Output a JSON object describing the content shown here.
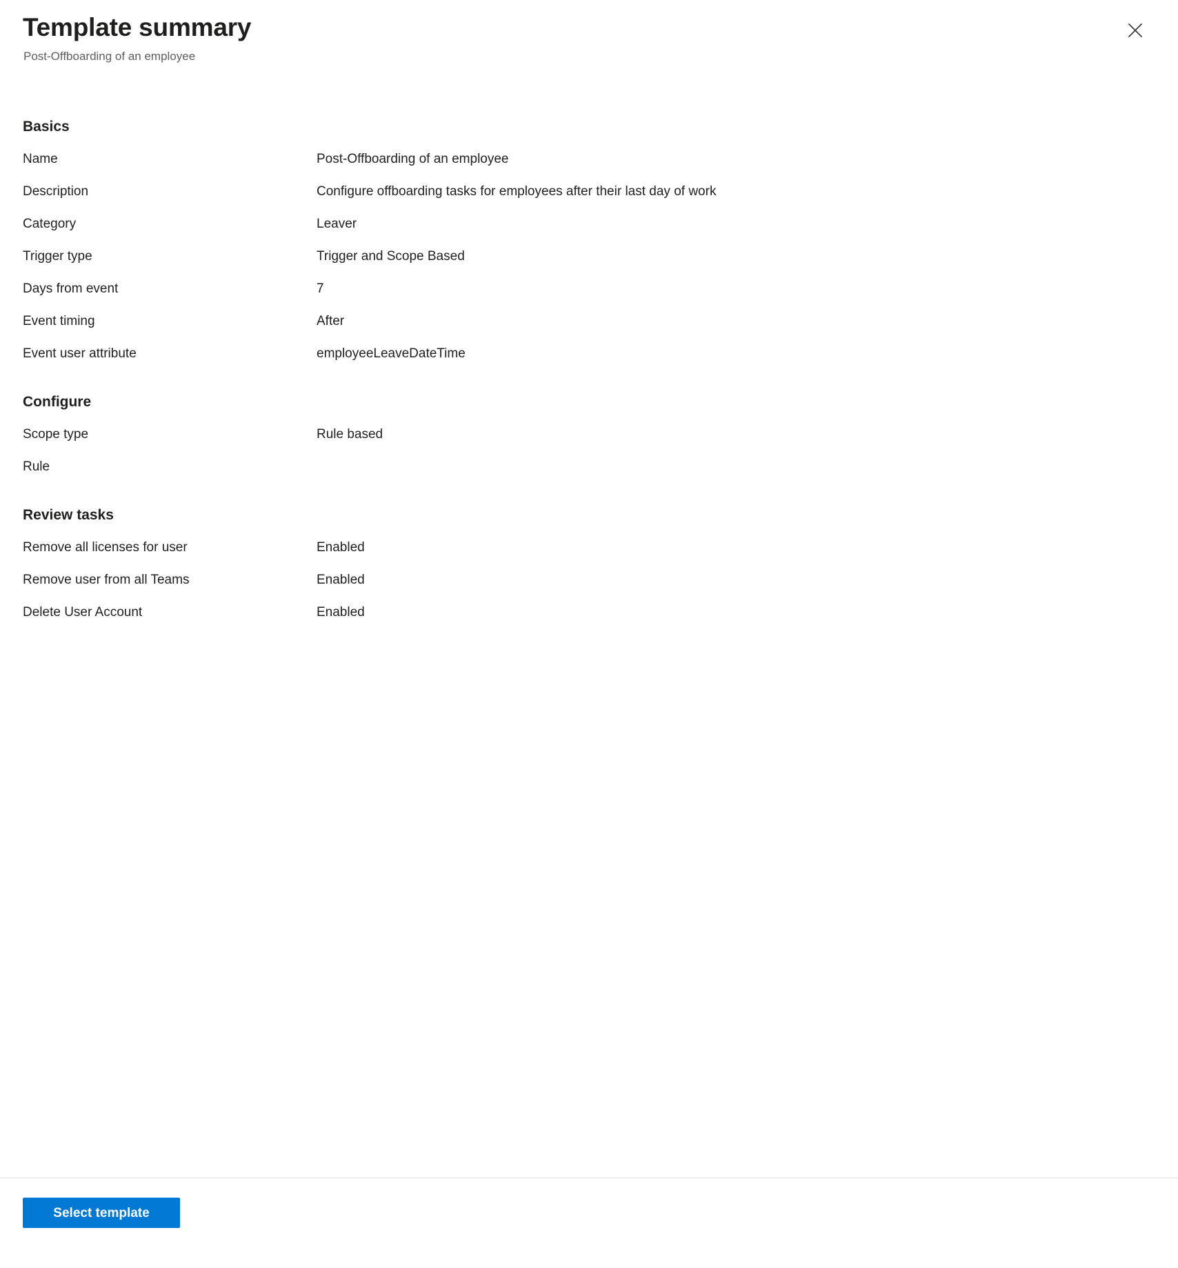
{
  "header": {
    "title": "Template summary",
    "subtitle": "Post-Offboarding of an employee",
    "close_icon": "close-icon"
  },
  "sections": [
    {
      "id": "basics",
      "title": "Basics",
      "rows": [
        {
          "label": "Name",
          "value": "Post-Offboarding of an employee"
        },
        {
          "label": "Description",
          "value": "Configure offboarding tasks for employees after their last day of work"
        },
        {
          "label": "Category",
          "value": "Leaver"
        },
        {
          "label": "Trigger type",
          "value": "Trigger and Scope Based"
        },
        {
          "label": "Days from event",
          "value": "7"
        },
        {
          "label": "Event timing",
          "value": "After"
        },
        {
          "label": "Event user attribute",
          "value": "employeeLeaveDateTime"
        }
      ]
    },
    {
      "id": "configure",
      "title": "Configure",
      "rows": [
        {
          "label": "Scope type",
          "value": "Rule based"
        },
        {
          "label": "Rule",
          "value": ""
        }
      ]
    },
    {
      "id": "review-tasks",
      "title": "Review tasks",
      "rows": [
        {
          "label": "Remove all licenses for user",
          "value": "Enabled"
        },
        {
          "label": "Remove user from all Teams",
          "value": "Enabled"
        },
        {
          "label": "Delete User Account",
          "value": "Enabled"
        }
      ]
    }
  ],
  "footer": {
    "primary_action": "Select template"
  },
  "colors": {
    "accent": "#0078d4",
    "text": "#201f1e",
    "secondary_text": "#605e5c",
    "divider": "#e1dfdd",
    "background": "#ffffff"
  }
}
